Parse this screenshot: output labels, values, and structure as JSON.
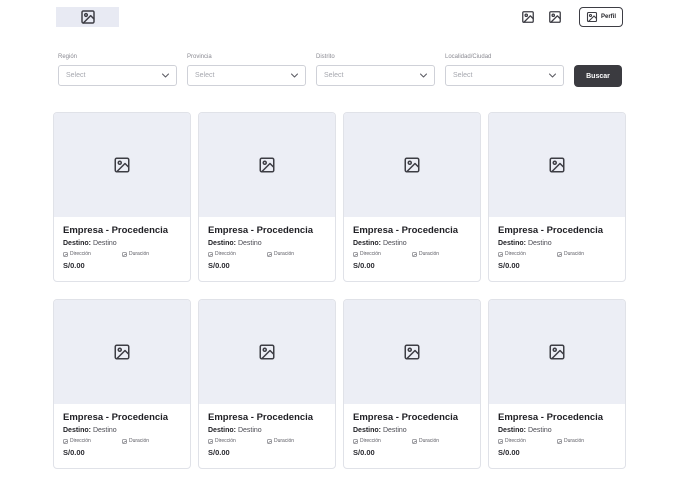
{
  "header": {
    "logo_icon": "image-icon",
    "profile_label": "Perfil"
  },
  "filters": [
    {
      "label": "Región",
      "placeholder": "Select"
    },
    {
      "label": "Provincia",
      "placeholder": "Select"
    },
    {
      "label": "Distrito",
      "placeholder": "Select"
    },
    {
      "label": "Localidad/Ciudad",
      "placeholder": "Select"
    }
  ],
  "search_label": "Buscar",
  "cards": [
    {
      "title": "Empresa - Procedencia",
      "dest_label": "Destino:",
      "dest_value": "Destino",
      "address": "Dirección",
      "duration": "Duración",
      "price": "S/0.00"
    },
    {
      "title": "Empresa - Procedencia",
      "dest_label": "Destino:",
      "dest_value": "Destino",
      "address": "Dirección",
      "duration": "Duración",
      "price": "S/0.00"
    },
    {
      "title": "Empresa - Procedencia",
      "dest_label": "Destino:",
      "dest_value": "Destino",
      "address": "Dirección",
      "duration": "Duración",
      "price": "S/0.00"
    },
    {
      "title": "Empresa - Procedencia",
      "dest_label": "Destino:",
      "dest_value": "Destino",
      "address": "Dirección",
      "duration": "Duración",
      "price": "S/0.00"
    },
    {
      "title": "Empresa - Procedencia",
      "dest_label": "Destino:",
      "dest_value": "Destino",
      "address": "Dirección",
      "duration": "Duración",
      "price": "S/0.00"
    },
    {
      "title": "Empresa - Procedencia",
      "dest_label": "Destino:",
      "dest_value": "Destino",
      "address": "Dirección",
      "duration": "Duración",
      "price": "S/0.00"
    },
    {
      "title": "Empresa - Procedencia",
      "dest_label": "Destino:",
      "dest_value": "Destino",
      "address": "Dirección",
      "duration": "Duración",
      "price": "S/0.00"
    },
    {
      "title": "Empresa - Procedencia",
      "dest_label": "Destino:",
      "dest_value": "Destino",
      "address": "Dirección",
      "duration": "Duración",
      "price": "S/0.00"
    }
  ],
  "colors": {
    "image_placeholder_bg": "#eceef5",
    "primary_button": "#3b3b40"
  }
}
